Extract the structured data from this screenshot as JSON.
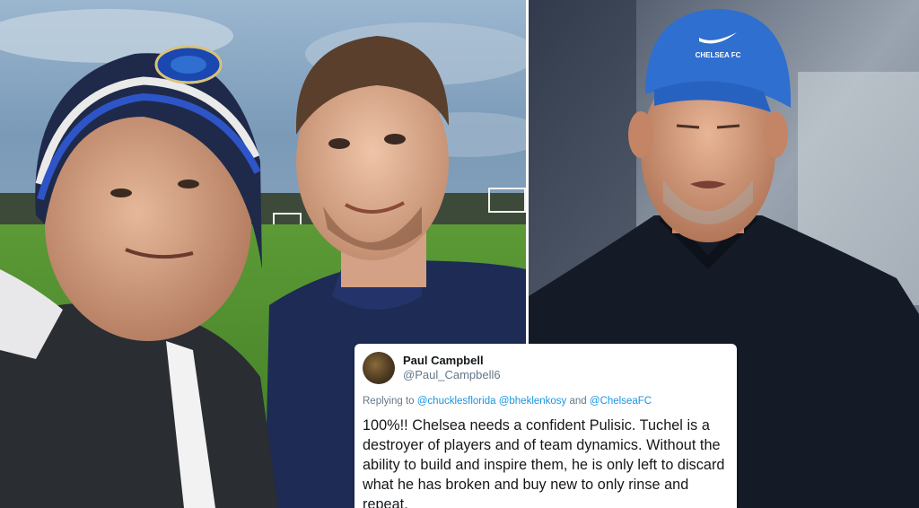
{
  "tweet": {
    "name": "Paul Campbell",
    "handle": "@Paul_Campbell6",
    "replying_prefix": "Replying to",
    "mention_1": "@chucklesflorida",
    "mention_2": "@bheklenkosy",
    "and_word": "and",
    "mention_3": "@ChelseaFC",
    "text": "100%!! Chelsea needs a confident Pulisic. Tuchel is a destroyer of players and of team dynamics. Without the ability to build and inspire them, he is only left to discard what he has broken and buy new to only rinse and repeat."
  },
  "photo_left": {
    "hat_logo": "Chelsea crest"
  },
  "photo_right": {
    "cap_brand": "nike-swoosh",
    "cap_text": "CHELSEA FC"
  },
  "colors": {
    "mention": "#1b95e0",
    "cap_blue": "#2f6fd0",
    "sky": "#7da0bd",
    "grass": "#4f8a2e"
  }
}
